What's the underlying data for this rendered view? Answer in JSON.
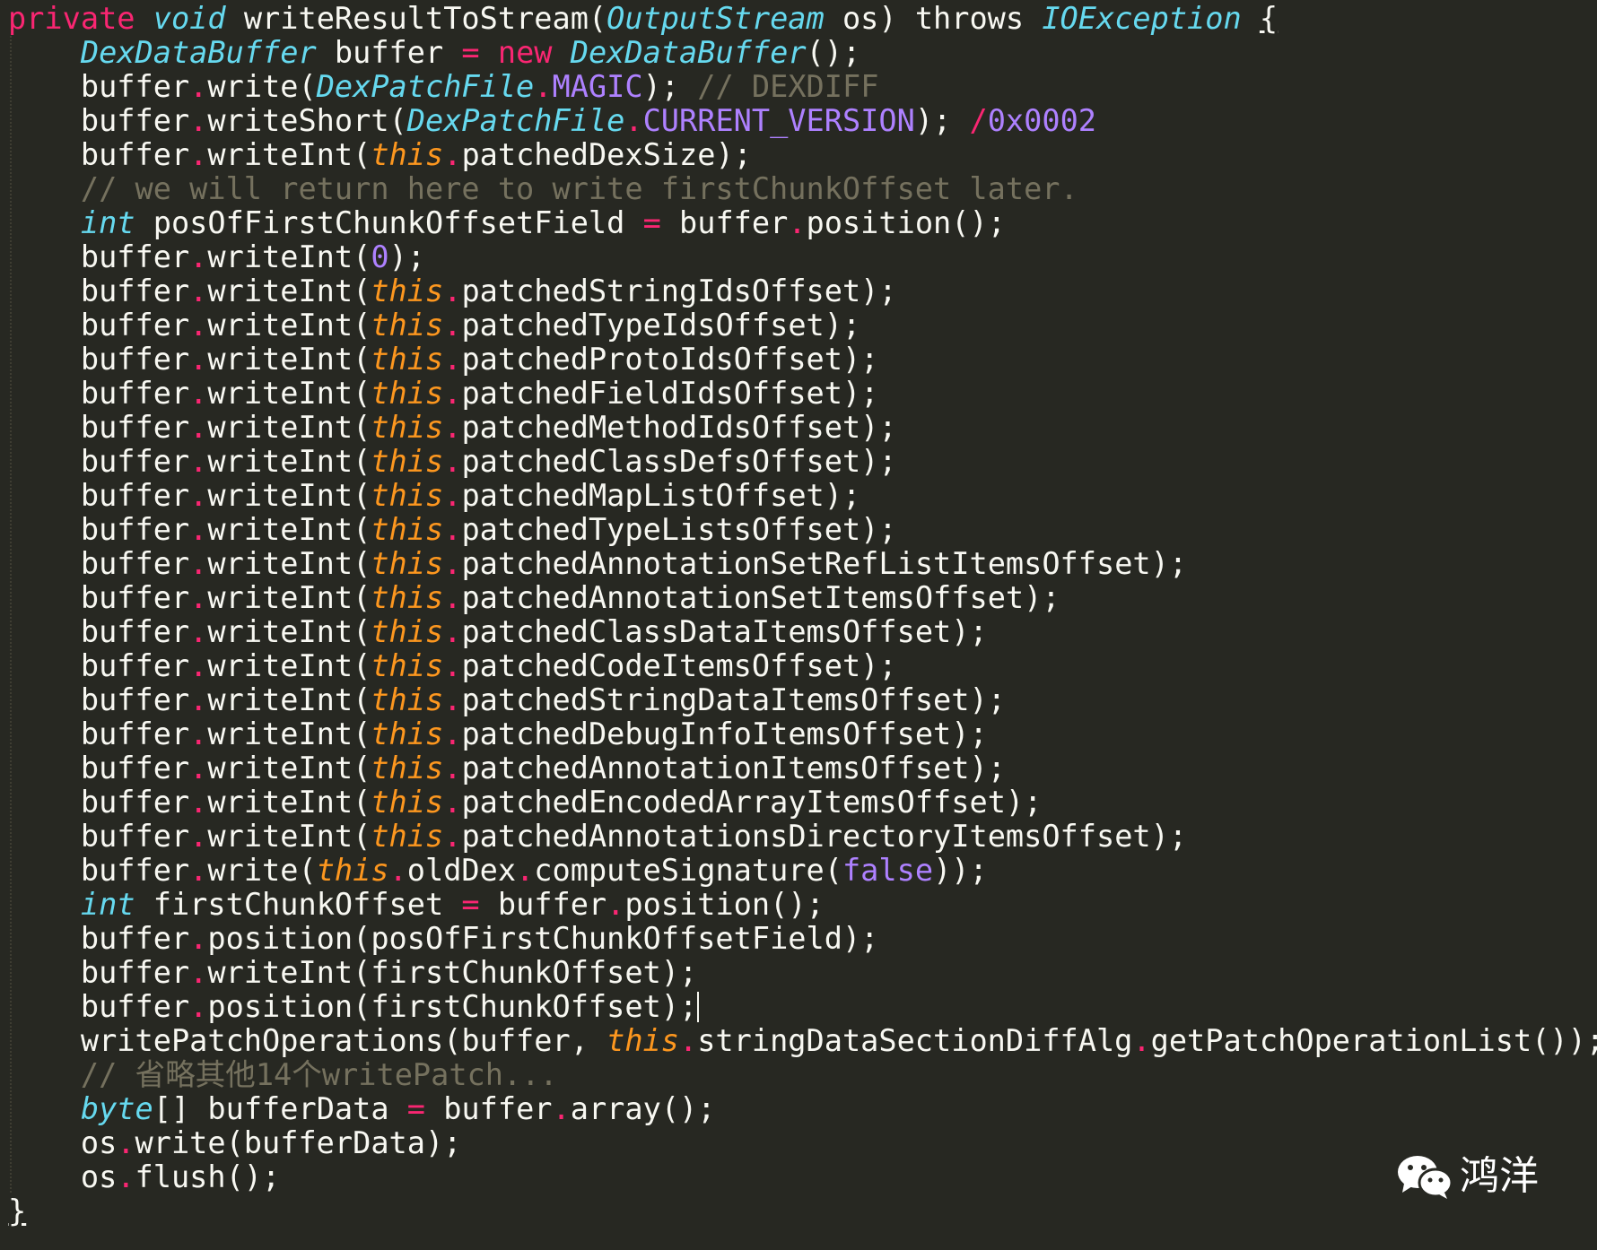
{
  "editor": {
    "theme_colors": {
      "background": "#272822",
      "foreground": "#f8f8f2",
      "keyword": "#f92672",
      "type": "#66d9ef",
      "this_keyword": "#fd971f",
      "constant": "#ae81ff",
      "comment": "#75715e"
    },
    "lines": [
      [
        [
          "kw",
          "private"
        ],
        [
          "plain",
          " "
        ],
        [
          "type",
          "void"
        ],
        [
          "plain",
          " writeResultToStream("
        ],
        [
          "type",
          "OutputStream"
        ],
        [
          "plain",
          " os) throws "
        ],
        [
          "type",
          "IOException"
        ],
        [
          "plain",
          " "
        ],
        [
          "und",
          "{"
        ]
      ],
      [
        [
          "plain",
          "    "
        ],
        [
          "type",
          "DexDataBuffer"
        ],
        [
          "plain",
          " buffer "
        ],
        [
          "op",
          "="
        ],
        [
          "plain",
          " "
        ],
        [
          "kw",
          "new"
        ],
        [
          "plain",
          " "
        ],
        [
          "type",
          "DexDataBuffer"
        ],
        [
          "plain",
          "();"
        ]
      ],
      [
        [
          "plain",
          "    buffer"
        ],
        [
          "op",
          "."
        ],
        [
          "plain",
          "write("
        ],
        [
          "type",
          "DexPatchFile"
        ],
        [
          "op",
          "."
        ],
        [
          "const",
          "MAGIC"
        ],
        [
          "plain",
          "); "
        ],
        [
          "com",
          "// DEXDIFF"
        ]
      ],
      [
        [
          "plain",
          "    buffer"
        ],
        [
          "op",
          "."
        ],
        [
          "plain",
          "writeShort("
        ],
        [
          "type",
          "DexPatchFile"
        ],
        [
          "op",
          "."
        ],
        [
          "const",
          "CURRENT_VERSION"
        ],
        [
          "plain",
          "); "
        ],
        [
          "op",
          "/"
        ],
        [
          "const",
          "0x0002"
        ]
      ],
      [
        [
          "plain",
          "    buffer"
        ],
        [
          "op",
          "."
        ],
        [
          "plain",
          "writeInt("
        ],
        [
          "this",
          "this"
        ],
        [
          "op",
          "."
        ],
        [
          "plain",
          "patchedDexSize);"
        ]
      ],
      [
        [
          "com",
          "    // we will return here to write firstChunkOffset later."
        ]
      ],
      [
        [
          "plain",
          "    "
        ],
        [
          "type",
          "int"
        ],
        [
          "plain",
          " posOfFirstChunkOffsetField "
        ],
        [
          "op",
          "="
        ],
        [
          "plain",
          " buffer"
        ],
        [
          "op",
          "."
        ],
        [
          "plain",
          "position();"
        ]
      ],
      [
        [
          "plain",
          "    buffer"
        ],
        [
          "op",
          "."
        ],
        [
          "plain",
          "writeInt("
        ],
        [
          "num",
          "0"
        ],
        [
          "plain",
          ");"
        ]
      ],
      [
        [
          "plain",
          "    buffer"
        ],
        [
          "op",
          "."
        ],
        [
          "plain",
          "writeInt("
        ],
        [
          "this",
          "this"
        ],
        [
          "op",
          "."
        ],
        [
          "plain",
          "patchedStringIdsOffset);"
        ]
      ],
      [
        [
          "plain",
          "    buffer"
        ],
        [
          "op",
          "."
        ],
        [
          "plain",
          "writeInt("
        ],
        [
          "this",
          "this"
        ],
        [
          "op",
          "."
        ],
        [
          "plain",
          "patchedTypeIdsOffset);"
        ]
      ],
      [
        [
          "plain",
          "    buffer"
        ],
        [
          "op",
          "."
        ],
        [
          "plain",
          "writeInt("
        ],
        [
          "this",
          "this"
        ],
        [
          "op",
          "."
        ],
        [
          "plain",
          "patchedProtoIdsOffset);"
        ]
      ],
      [
        [
          "plain",
          "    buffer"
        ],
        [
          "op",
          "."
        ],
        [
          "plain",
          "writeInt("
        ],
        [
          "this",
          "this"
        ],
        [
          "op",
          "."
        ],
        [
          "plain",
          "patchedFieldIdsOffset);"
        ]
      ],
      [
        [
          "plain",
          "    buffer"
        ],
        [
          "op",
          "."
        ],
        [
          "plain",
          "writeInt("
        ],
        [
          "this",
          "this"
        ],
        [
          "op",
          "."
        ],
        [
          "plain",
          "patchedMethodIdsOffset);"
        ]
      ],
      [
        [
          "plain",
          "    buffer"
        ],
        [
          "op",
          "."
        ],
        [
          "plain",
          "writeInt("
        ],
        [
          "this",
          "this"
        ],
        [
          "op",
          "."
        ],
        [
          "plain",
          "patchedClassDefsOffset);"
        ]
      ],
      [
        [
          "plain",
          "    buffer"
        ],
        [
          "op",
          "."
        ],
        [
          "plain",
          "writeInt("
        ],
        [
          "this",
          "this"
        ],
        [
          "op",
          "."
        ],
        [
          "plain",
          "patchedMapListOffset);"
        ]
      ],
      [
        [
          "plain",
          "    buffer"
        ],
        [
          "op",
          "."
        ],
        [
          "plain",
          "writeInt("
        ],
        [
          "this",
          "this"
        ],
        [
          "op",
          "."
        ],
        [
          "plain",
          "patchedTypeListsOffset);"
        ]
      ],
      [
        [
          "plain",
          "    buffer"
        ],
        [
          "op",
          "."
        ],
        [
          "plain",
          "writeInt("
        ],
        [
          "this",
          "this"
        ],
        [
          "op",
          "."
        ],
        [
          "plain",
          "patchedAnnotationSetRefListItemsOffset);"
        ]
      ],
      [
        [
          "plain",
          "    buffer"
        ],
        [
          "op",
          "."
        ],
        [
          "plain",
          "writeInt("
        ],
        [
          "this",
          "this"
        ],
        [
          "op",
          "."
        ],
        [
          "plain",
          "patchedAnnotationSetItemsOffset);"
        ]
      ],
      [
        [
          "plain",
          "    buffer"
        ],
        [
          "op",
          "."
        ],
        [
          "plain",
          "writeInt("
        ],
        [
          "this",
          "this"
        ],
        [
          "op",
          "."
        ],
        [
          "plain",
          "patchedClassDataItemsOffset);"
        ]
      ],
      [
        [
          "plain",
          "    buffer"
        ],
        [
          "op",
          "."
        ],
        [
          "plain",
          "writeInt("
        ],
        [
          "this",
          "this"
        ],
        [
          "op",
          "."
        ],
        [
          "plain",
          "patchedCodeItemsOffset);"
        ]
      ],
      [
        [
          "plain",
          "    buffer"
        ],
        [
          "op",
          "."
        ],
        [
          "plain",
          "writeInt("
        ],
        [
          "this",
          "this"
        ],
        [
          "op",
          "."
        ],
        [
          "plain",
          "patchedStringDataItemsOffset);"
        ]
      ],
      [
        [
          "plain",
          "    buffer"
        ],
        [
          "op",
          "."
        ],
        [
          "plain",
          "writeInt("
        ],
        [
          "this",
          "this"
        ],
        [
          "op",
          "."
        ],
        [
          "plain",
          "patchedDebugInfoItemsOffset);"
        ]
      ],
      [
        [
          "plain",
          "    buffer"
        ],
        [
          "op",
          "."
        ],
        [
          "plain",
          "writeInt("
        ],
        [
          "this",
          "this"
        ],
        [
          "op",
          "."
        ],
        [
          "plain",
          "patchedAnnotationItemsOffset);"
        ]
      ],
      [
        [
          "plain",
          "    buffer"
        ],
        [
          "op",
          "."
        ],
        [
          "plain",
          "writeInt("
        ],
        [
          "this",
          "this"
        ],
        [
          "op",
          "."
        ],
        [
          "plain",
          "patchedEncodedArrayItemsOffset);"
        ]
      ],
      [
        [
          "plain",
          "    buffer"
        ],
        [
          "op",
          "."
        ],
        [
          "plain",
          "writeInt("
        ],
        [
          "this",
          "this"
        ],
        [
          "op",
          "."
        ],
        [
          "plain",
          "patchedAnnotationsDirectoryItemsOffset);"
        ]
      ],
      [
        [
          "plain",
          "    buffer"
        ],
        [
          "op",
          "."
        ],
        [
          "plain",
          "write("
        ],
        [
          "this",
          "this"
        ],
        [
          "op",
          "."
        ],
        [
          "plain",
          "oldDex"
        ],
        [
          "op",
          "."
        ],
        [
          "plain",
          "computeSignature("
        ],
        [
          "const",
          "false"
        ],
        [
          "plain",
          "));"
        ]
      ],
      [
        [
          "plain",
          "    "
        ],
        [
          "type",
          "int"
        ],
        [
          "plain",
          " firstChunkOffset "
        ],
        [
          "op",
          "="
        ],
        [
          "plain",
          " buffer"
        ],
        [
          "op",
          "."
        ],
        [
          "plain",
          "position();"
        ]
      ],
      [
        [
          "plain",
          "    buffer"
        ],
        [
          "op",
          "."
        ],
        [
          "plain",
          "position(posOfFirstChunkOffsetField);"
        ]
      ],
      [
        [
          "plain",
          "    buffer"
        ],
        [
          "op",
          "."
        ],
        [
          "plain",
          "writeInt(firstChunkOffset);"
        ]
      ],
      [
        [
          "plain",
          "    buffer"
        ],
        [
          "op",
          "."
        ],
        [
          "plain",
          "position(firstChunkOffset);"
        ],
        [
          "caret",
          ""
        ]
      ],
      [
        [
          "plain",
          "    writePatchOperations(buffer, "
        ],
        [
          "this",
          "this"
        ],
        [
          "op",
          "."
        ],
        [
          "plain",
          "stringDataSectionDiffAlg"
        ],
        [
          "op",
          "."
        ],
        [
          "plain",
          "getPatchOperationList());"
        ]
      ],
      [
        [
          "com",
          "    // 省略其他14个writePatch..."
        ]
      ],
      [
        [
          "plain",
          "    "
        ],
        [
          "type",
          "byte"
        ],
        [
          "plain",
          "[] bufferData "
        ],
        [
          "op",
          "="
        ],
        [
          "plain",
          " buffer"
        ],
        [
          "op",
          "."
        ],
        [
          "plain",
          "array();"
        ]
      ],
      [
        [
          "plain",
          "    os"
        ],
        [
          "op",
          "."
        ],
        [
          "plain",
          "write(bufferData);"
        ]
      ],
      [
        [
          "plain",
          "    os"
        ],
        [
          "op",
          "."
        ],
        [
          "plain",
          "flush();"
        ]
      ],
      [
        [
          "und",
          "}"
        ]
      ]
    ]
  },
  "watermark": {
    "icon": "wechat-icon",
    "text": "鸿洋"
  }
}
